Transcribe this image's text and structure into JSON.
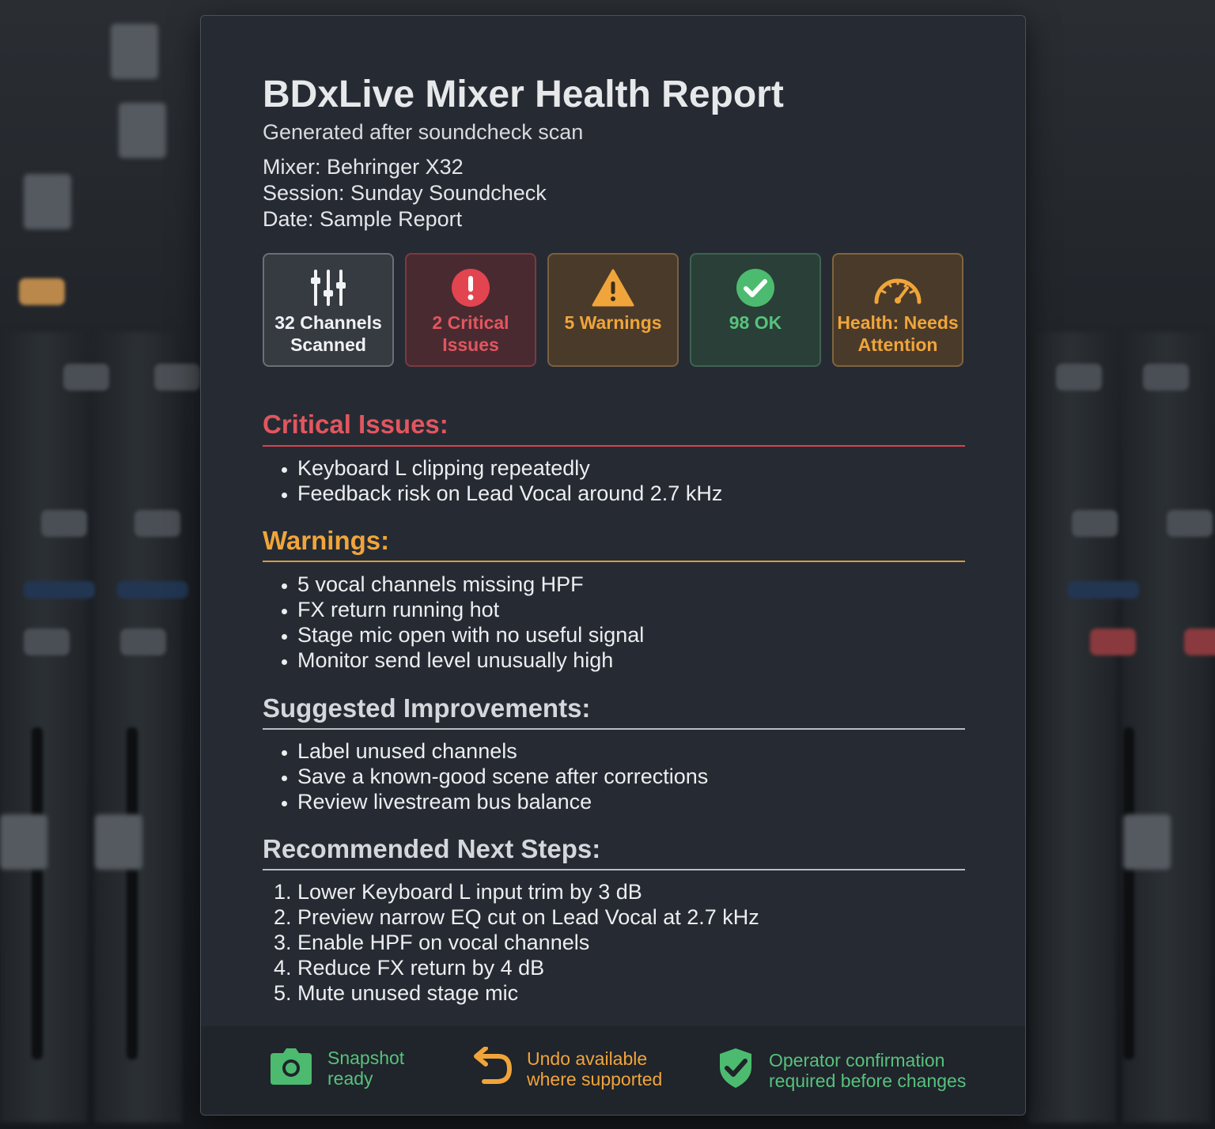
{
  "report": {
    "title": "BDxLive Mixer Health Report",
    "subtitle": "Generated after soundcheck scan",
    "mixer": "Mixer: Behringer X32",
    "session": "Session: Sunday Soundcheck",
    "date": "Date: Sample Report"
  },
  "summary_cards": [
    {
      "line1": "32 Channels",
      "line2": "Scanned",
      "icon": "sliders-icon",
      "color": "#f1f2f3"
    },
    {
      "line1": "2 Critical",
      "line2": "Issues",
      "icon": "error-icon",
      "color": "#e2565f"
    },
    {
      "line1": "5 Warnings",
      "line2": "",
      "icon": "warning-icon",
      "color": "#f0a53a"
    },
    {
      "line1": "98 OK",
      "line2": "",
      "icon": "check-circle-icon",
      "color": "#57c27c"
    },
    {
      "line1": "Health: Needs",
      "line2": "Attention",
      "icon": "gauge-icon",
      "color": "#f0a53a"
    }
  ],
  "critical": {
    "title": "Critical Issues:",
    "color": "#e2565f",
    "items": [
      "Keyboard L clipping repeatedly",
      "Feedback risk on Lead Vocal around 2.7 kHz"
    ]
  },
  "warnings": {
    "title": "Warnings:",
    "color": "#f0a53a",
    "items": [
      "5 vocal channels missing HPF",
      "FX return running hot",
      "Stage mic open with no useful signal",
      "Monitor send level unusually high"
    ]
  },
  "improvements": {
    "title": "Suggested Improvements:",
    "color": "#d4d7db",
    "items": [
      "Label unused channels",
      "Save a known-good scene after corrections",
      "Review livestream bus balance"
    ]
  },
  "next_steps": {
    "title": "Recommended Next Steps:",
    "color": "#d4d7db",
    "items": [
      "Lower Keyboard L input trim by 3 dB",
      "Preview narrow EQ cut on Lead Vocal at 2.7 kHz",
      "Enable HPF on vocal channels",
      "Reduce FX return by 4 dB",
      "Mute unused stage mic"
    ]
  },
  "footer": {
    "snapshot": {
      "line1": "Snapshot",
      "line2": "ready",
      "icon": "camera-icon",
      "color": "#57c27c"
    },
    "undo": {
      "line1": "Undo available",
      "line2": "where supported",
      "icon": "undo-icon",
      "color": "#f0a53a"
    },
    "confirm": {
      "line1": "Operator confirmation",
      "line2": "required before changes",
      "icon": "shield-check-icon",
      "color": "#57c27c"
    }
  }
}
